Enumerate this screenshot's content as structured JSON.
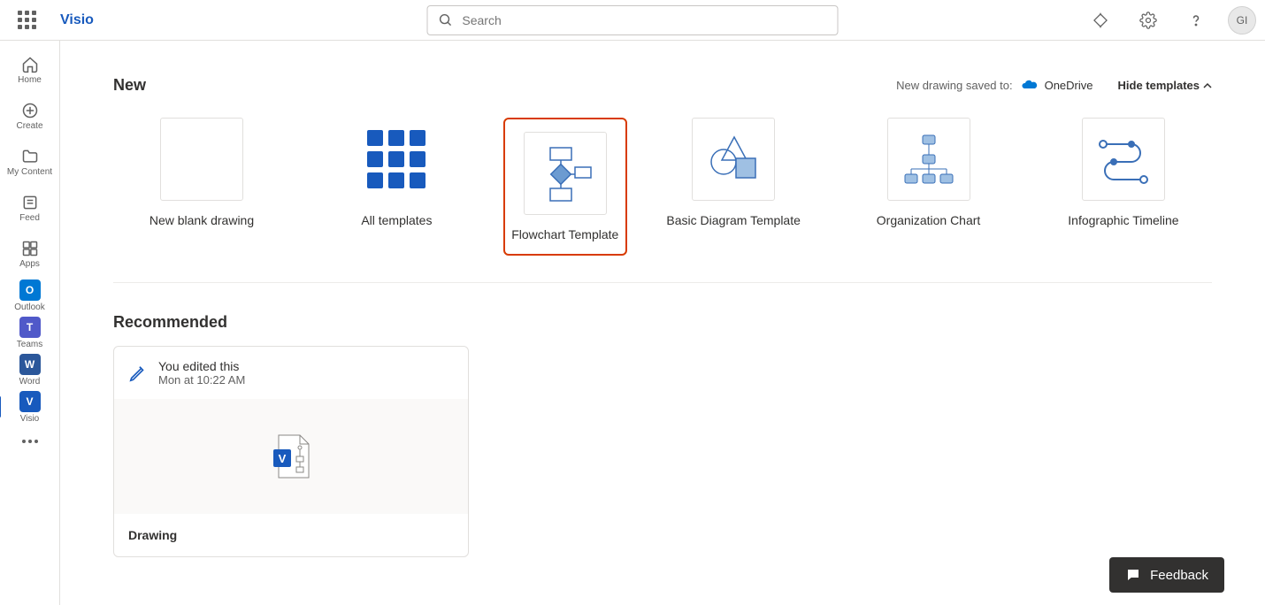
{
  "header": {
    "app_title": "Visio",
    "search_placeholder": "Search",
    "avatar_initials": "GI"
  },
  "rail": {
    "home": "Home",
    "create": "Create",
    "my_content": "My Content",
    "feed": "Feed",
    "apps": "Apps",
    "outlook": "Outlook",
    "teams": "Teams",
    "word": "Word",
    "visio": "Visio"
  },
  "new_section": {
    "title": "New",
    "saved_to_label": "New drawing saved to:",
    "saved_to_location": "OneDrive",
    "hide_templates_label": "Hide templates"
  },
  "templates": [
    {
      "label": "New blank drawing"
    },
    {
      "label": "All templates"
    },
    {
      "label": "Flowchart Template"
    },
    {
      "label": "Basic Diagram Template"
    },
    {
      "label": "Organization Chart"
    },
    {
      "label": "Infographic Timeline"
    }
  ],
  "recommended": {
    "title": "Recommended",
    "card": {
      "line1": "You edited this",
      "line2": "Mon at 10:22 AM",
      "filename": "Drawing"
    }
  },
  "feedback": {
    "label": "Feedback"
  }
}
